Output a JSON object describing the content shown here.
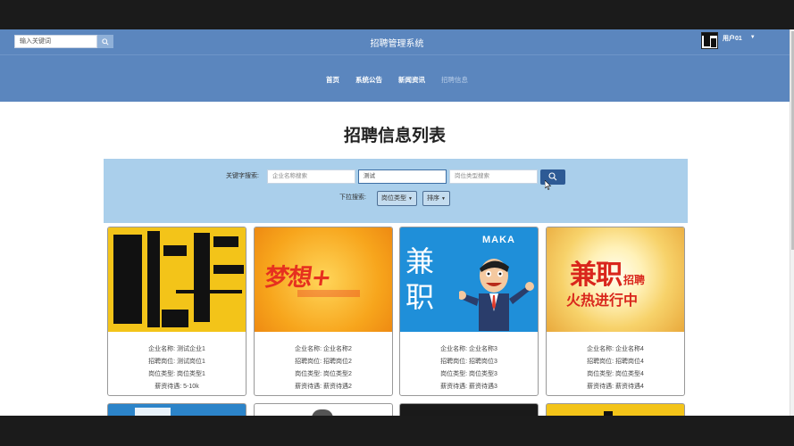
{
  "header": {
    "search_placeholder": "输入关键词",
    "title": "招聘管理系统",
    "username": "用户01"
  },
  "nav": {
    "items": [
      {
        "label": "首页"
      },
      {
        "label": "系统公告"
      },
      {
        "label": "新闻资讯"
      },
      {
        "label": "招聘信息"
      }
    ]
  },
  "page": {
    "title": "招聘信息列表"
  },
  "filters": {
    "keyword_label": "关键字搜索:",
    "company_placeholder": "企业名称搜索",
    "position_value": "测试",
    "type_placeholder": "岗位类型搜索",
    "dropdown_label": "下拉搜索:",
    "type_dropdown": "岗位类型",
    "sort_dropdown": "排序"
  },
  "cards": [
    {
      "company": "企业名称: 测试企业1",
      "position": "招聘岗位: 测试岗位1",
      "type": "岗位类型: 岗位类型1",
      "salary": "薪资待遇: 5-10k",
      "image_text": "聘"
    },
    {
      "company": "企业名称: 企业名称2",
      "position": "招聘岗位: 招聘岗位2",
      "type": "岗位类型: 岗位类型2",
      "salary": "薪资待遇: 薪资待遇2",
      "image_text": "梦想+"
    },
    {
      "company": "企业名称: 企业名称3",
      "position": "招聘岗位: 招聘岗位3",
      "type": "岗位类型: 岗位类型3",
      "salary": "薪资待遇: 薪资待遇3",
      "image_text": "兼职",
      "image_brand": "MAKA"
    },
    {
      "company": "企业名称: 企业名称4",
      "position": "招聘岗位: 招聘岗位4",
      "type": "岗位类型: 岗位类型4",
      "salary": "薪资待遇: 薪资待遇4",
      "image_text": "兼职",
      "image_text2": "招聘",
      "image_text3": "火热进行中"
    }
  ],
  "colors": {
    "header_bg": "#5b86be",
    "filter_bg": "#aacfeb",
    "search_button": "#2d5a95"
  }
}
